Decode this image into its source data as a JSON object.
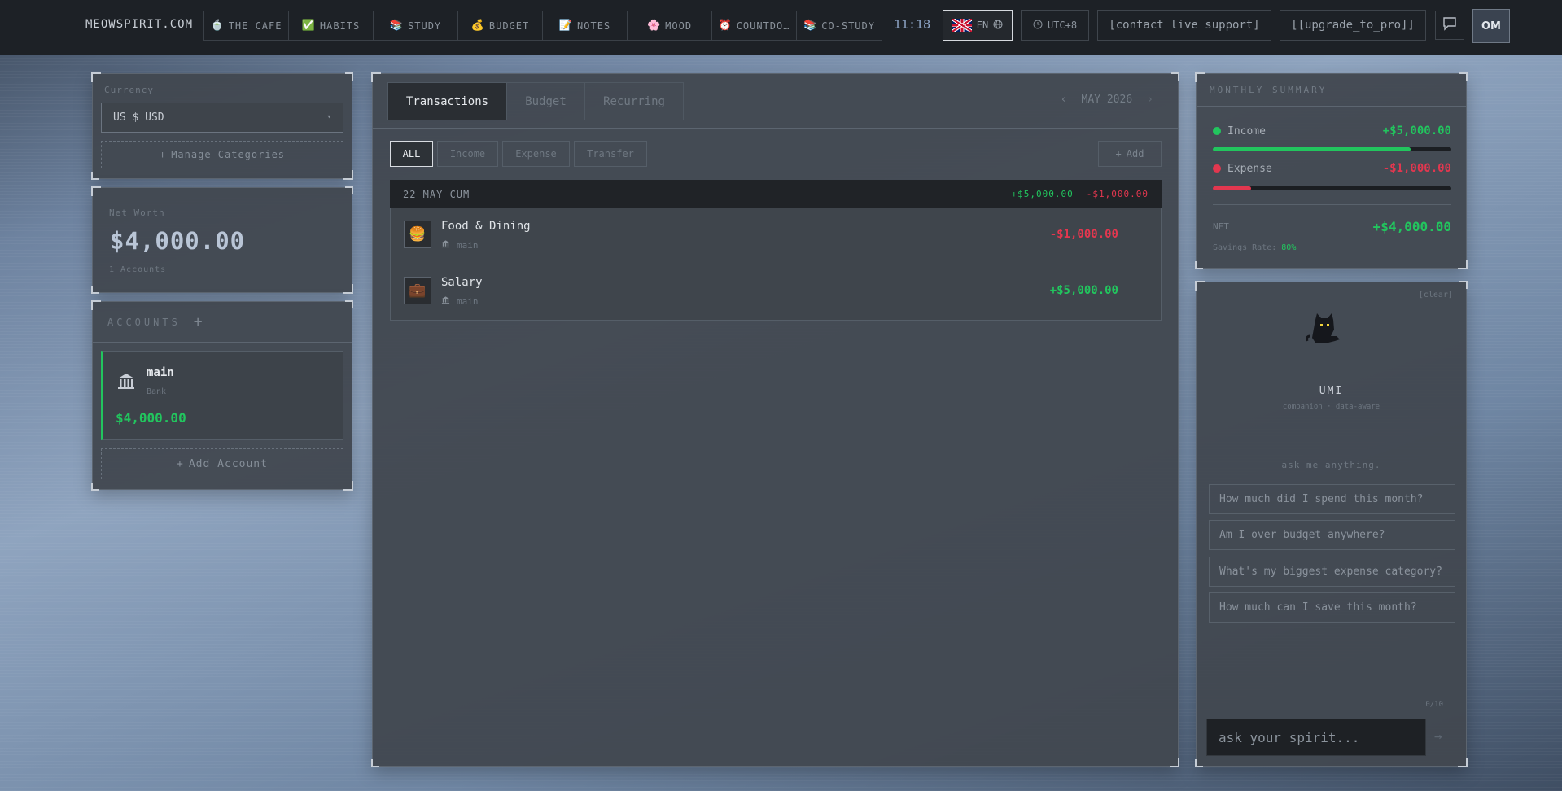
{
  "header": {
    "brand": "MEOWSPIRIT.COM",
    "nav": [
      {
        "label": "THE CAFE",
        "icon": "bowl-icon",
        "glyph": "🍵"
      },
      {
        "label": "HABITS",
        "icon": "checkmark-icon",
        "glyph": "✅"
      },
      {
        "label": "STUDY",
        "icon": "books-icon",
        "glyph": "📚"
      },
      {
        "label": "BUDGET",
        "icon": "money-bag-icon",
        "glyph": "💰"
      },
      {
        "label": "NOTES",
        "icon": "memo-icon",
        "glyph": "📝"
      },
      {
        "label": "MOOD",
        "icon": "flower-icon",
        "glyph": "🌸"
      },
      {
        "label": "COUNTDO…",
        "icon": "alarm-clock-icon",
        "glyph": "⏰"
      },
      {
        "label": "CO-STUDY",
        "icon": "books-icon",
        "glyph": "📚"
      }
    ],
    "clock": "11:18",
    "language": "EN",
    "timezone": "UTC+8",
    "support_label": "[contact live support]",
    "upgrade_label": "[[upgrade_to_pro]]",
    "avatar_initials": "OM"
  },
  "sidebar": {
    "currency_label": "Currency",
    "currency_value": "US $ USD",
    "manage_categories": "Manage Categories",
    "net_worth_label": "Net Worth",
    "net_worth_value": "$4,000.00",
    "accounts_count": "1 Accounts",
    "accounts_title": "ACCOUNTS",
    "account": {
      "name": "main",
      "type": "Bank",
      "balance": "$4,000.00"
    },
    "add_account": "Add Account"
  },
  "main": {
    "tabs": [
      "Transactions",
      "Budget",
      "Recurring"
    ],
    "active_tab": 0,
    "month_label": "MAY 2026",
    "filters": [
      "ALL",
      "Income",
      "Expense",
      "Transfer"
    ],
    "add_label": "Add",
    "day_header": {
      "label": "22 MAY CUM",
      "income": "+$5,000.00",
      "expense": "-$1,000.00"
    },
    "transactions": [
      {
        "title": "Food & Dining",
        "account": "main",
        "amount": "-$1,000.00",
        "type": "expense",
        "icon": "burger-icon",
        "glyph": "🍔"
      },
      {
        "title": "Salary",
        "account": "main",
        "amount": "+$5,000.00",
        "type": "income",
        "icon": "briefcase-icon",
        "glyph": "💼"
      }
    ]
  },
  "summary": {
    "title": "MONTHLY SUMMARY",
    "income_label": "Income",
    "income_value": "+$5,000.00",
    "income_bar_fraction": 0.83,
    "expense_label": "Expense",
    "expense_value": "-$1,000.00",
    "expense_bar_fraction": 0.16,
    "net_label": "NET",
    "net_value": "+$4,000.00",
    "savings_label": "Savings Rate:",
    "savings_value": "80%"
  },
  "spirit": {
    "clear_label": "[clear]",
    "name": "UMI",
    "subtitle": "companion · data-aware",
    "prompt": "ask me anything.",
    "suggestions": [
      "How much did I spend this month?",
      "Am I over budget anywhere?",
      "What's my biggest expense category?",
      "How much can I save this month?"
    ],
    "counter": "0/10",
    "input_placeholder": "ask your spirit..."
  },
  "colors": {
    "income": "#22c55e",
    "expense": "#e2374f",
    "accent": "#8fa6c8"
  }
}
